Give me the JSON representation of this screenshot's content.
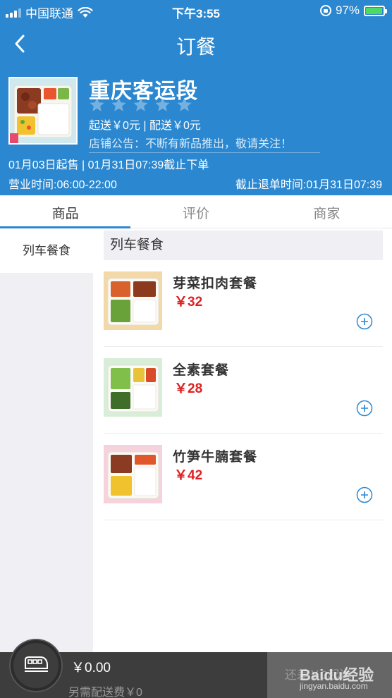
{
  "status_bar": {
    "carrier": "中国联通",
    "time": "下午3:55",
    "battery": "97%",
    "battery_level": 0.97
  },
  "nav": {
    "title": "订餐"
  },
  "store": {
    "name": "重庆客运段",
    "rating_stars": 0,
    "rating_max": 5,
    "delivery_info": "起送￥0元 | 配送￥0元",
    "notice": "店铺公告：不断有新品推出，敬请关注！",
    "sale_period": "01月03日起售 | 01月31日07:39截止下单",
    "business_hours": "营业时间:06:00-22:00",
    "refund_deadline": "截止退单时间:01月31日07:39"
  },
  "tabs": [
    {
      "label": "商品",
      "active": true
    },
    {
      "label": "评价",
      "active": false
    },
    {
      "label": "商家",
      "active": false
    }
  ],
  "sidebar": {
    "categories": [
      {
        "label": "列车餐食",
        "active": true
      }
    ]
  },
  "menu": {
    "section_title": "列车餐食",
    "items": [
      {
        "name": "芽菜扣肉套餐",
        "price": "￥32"
      },
      {
        "name": "全素套餐",
        "price": "￥28"
      },
      {
        "name": "竹笋牛腩套餐",
        "price": "￥42"
      }
    ]
  },
  "cart": {
    "total": "￥0.00",
    "delivery_fee_note": "另需配送费￥0",
    "checkout_label": "还差￥0起送"
  },
  "watermark": {
    "brand": "Baidu经验",
    "url": "jingyan.baidu.com"
  },
  "colors": {
    "primary": "#2b87cf",
    "price": "#e02020",
    "bottom_bar": "#3d3d3d"
  }
}
